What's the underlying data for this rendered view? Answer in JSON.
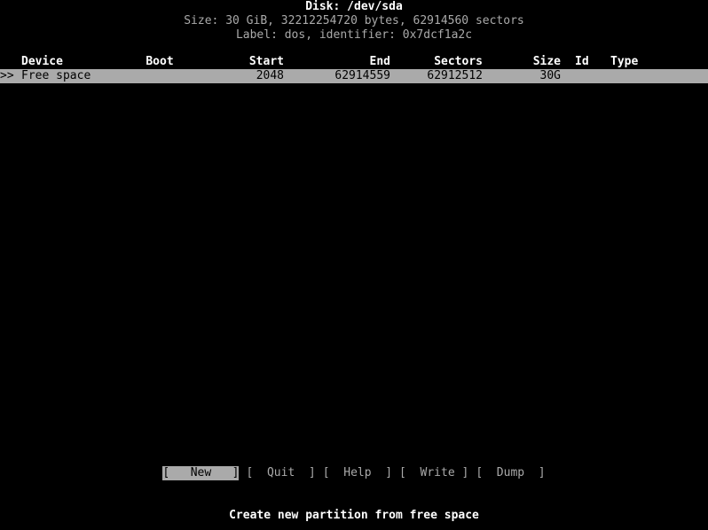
{
  "header": {
    "disk_title": "Disk: /dev/sda",
    "disk_size": "Size: 30 GiB, 32212254720 bytes, 62914560 sectors",
    "disk_label": "Label: dos, identifier: 0x7dcf1a2c"
  },
  "table": {
    "columns": {
      "device": "Device",
      "boot": "Boot",
      "start": "Start",
      "end": "End",
      "sectors": "Sectors",
      "size": "Size",
      "id": "Id",
      "type": "Type"
    },
    "rows": [
      {
        "marker": ">>",
        "device": "Free space",
        "boot": "",
        "start": "2048",
        "end": "62914559",
        "sectors": "62912512",
        "size": "30G",
        "id": "",
        "type": "",
        "selected": true
      }
    ]
  },
  "menu": {
    "items": [
      {
        "label": "[   New   ]",
        "name": "new",
        "selected": true
      },
      {
        "label": "[  Quit  ]",
        "name": "quit",
        "selected": false
      },
      {
        "label": "[  Help  ]",
        "name": "help",
        "selected": false
      },
      {
        "label": "[  Write ]",
        "name": "write",
        "selected": false
      },
      {
        "label": "[  Dump  ]",
        "name": "dump",
        "selected": false
      }
    ]
  },
  "status": {
    "text": "Create new partition from free space"
  },
  "colors": {
    "background": "#000000",
    "foreground": "#aaaaaa",
    "bright": "#ffffff",
    "highlight_bg": "#aaaaaa",
    "highlight_fg": "#000000"
  }
}
